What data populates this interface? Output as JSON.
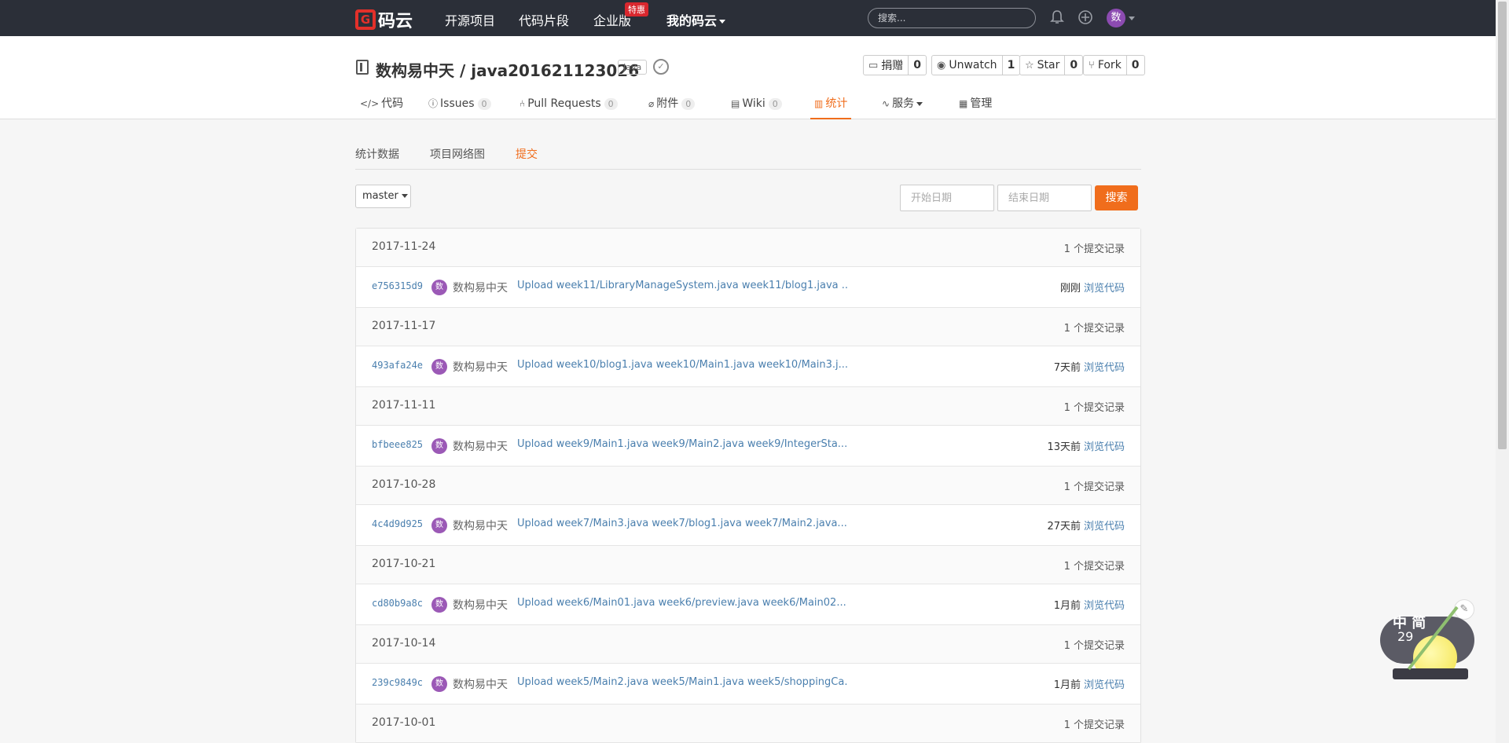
{
  "topnav": {
    "logo_mark": "G",
    "logo_text": "码云",
    "items": [
      "开源项目",
      "代码片段",
      "企业版",
      "我的码云"
    ],
    "enterprise_badge": "特惠",
    "search_placeholder": "搜索...",
    "avatar_char": "数"
  },
  "repo": {
    "title": "数构易中天 / java201621123026",
    "language": "Java",
    "actions": [
      {
        "icon": "donate-icon",
        "label": "捐赠",
        "count": "0"
      },
      {
        "icon": "eye-icon",
        "label": "Unwatch",
        "count": "1"
      },
      {
        "icon": "star-icon",
        "label": "Star",
        "count": "0"
      },
      {
        "icon": "fork-icon",
        "label": "Fork",
        "count": "0"
      }
    ],
    "tabs": [
      {
        "label": "代码",
        "count": null,
        "icon": "code-icon"
      },
      {
        "label": "Issues",
        "count": "0",
        "icon": "issue-icon"
      },
      {
        "label": "Pull Requests",
        "count": "0",
        "icon": "pull-request-icon"
      },
      {
        "label": "附件",
        "count": "0",
        "icon": "paperclip-icon"
      },
      {
        "label": "Wiki",
        "count": "0",
        "icon": "book-icon"
      },
      {
        "label": "统计",
        "count": null,
        "icon": "chart-icon"
      },
      {
        "label": "服务",
        "count": null,
        "icon": "pulse-icon"
      },
      {
        "label": "管理",
        "count": null,
        "icon": "settings-doc-icon"
      }
    ],
    "active_tab": "统计"
  },
  "subtabs": [
    "统计数据",
    "项目网络图",
    "提交"
  ],
  "active_subtab": "提交",
  "filters": {
    "branch": "master",
    "start_placeholder": "开始日期",
    "end_placeholder": "结束日期",
    "search_label": "搜索"
  },
  "commit_days": [
    {
      "date": "2017-11-24",
      "count": "1 个提交记录",
      "commits": [
        {
          "sha": "e756315d9",
          "author": "数构易中天",
          "message": "Upload week11/LibraryManageSystem.java week11/blog1.java ...",
          "when": "刚刚",
          "browse": "浏览代码"
        }
      ]
    },
    {
      "date": "2017-11-17",
      "count": "1 个提交记录",
      "commits": [
        {
          "sha": "493afa24e",
          "author": "数构易中天",
          "message": "Upload week10/blog1.java week10/Main1.java week10/Main3.j...",
          "when": "7天前",
          "browse": "浏览代码"
        }
      ]
    },
    {
      "date": "2017-11-11",
      "count": "1 个提交记录",
      "commits": [
        {
          "sha": "bfbeee825",
          "author": "数构易中天",
          "message": "Upload week9/Main1.java week9/Main2.java week9/IntegerSta...",
          "when": "13天前",
          "browse": "浏览代码"
        }
      ]
    },
    {
      "date": "2017-10-28",
      "count": "1 个提交记录",
      "commits": [
        {
          "sha": "4c4d9d925",
          "author": "数构易中天",
          "message": "Upload week7/Main3.java week7/blog1.java week7/Main2.java...",
          "when": "27天前",
          "browse": "浏览代码"
        }
      ]
    },
    {
      "date": "2017-10-21",
      "count": "1 个提交记录",
      "commits": [
        {
          "sha": "cd80b9a8c",
          "author": "数构易中天",
          "message": "Upload week6/Main01.java week6/preview.java week6/Main02....",
          "when": "1月前",
          "browse": "浏览代码"
        }
      ]
    },
    {
      "date": "2017-10-14",
      "count": "1 个提交记录",
      "commits": [
        {
          "sha": "239c9849c",
          "author": "数构易中天",
          "message": "Upload week5/Main2.java week5/Main1.java week5/shoppingCa...",
          "when": "1月前",
          "browse": "浏览代码"
        }
      ]
    },
    {
      "date": "2017-10-01",
      "count": "1 个提交记录",
      "commits": []
    }
  ],
  "avatar_char_small": "数",
  "widget": {
    "text": "中  简",
    "num": "29"
  }
}
